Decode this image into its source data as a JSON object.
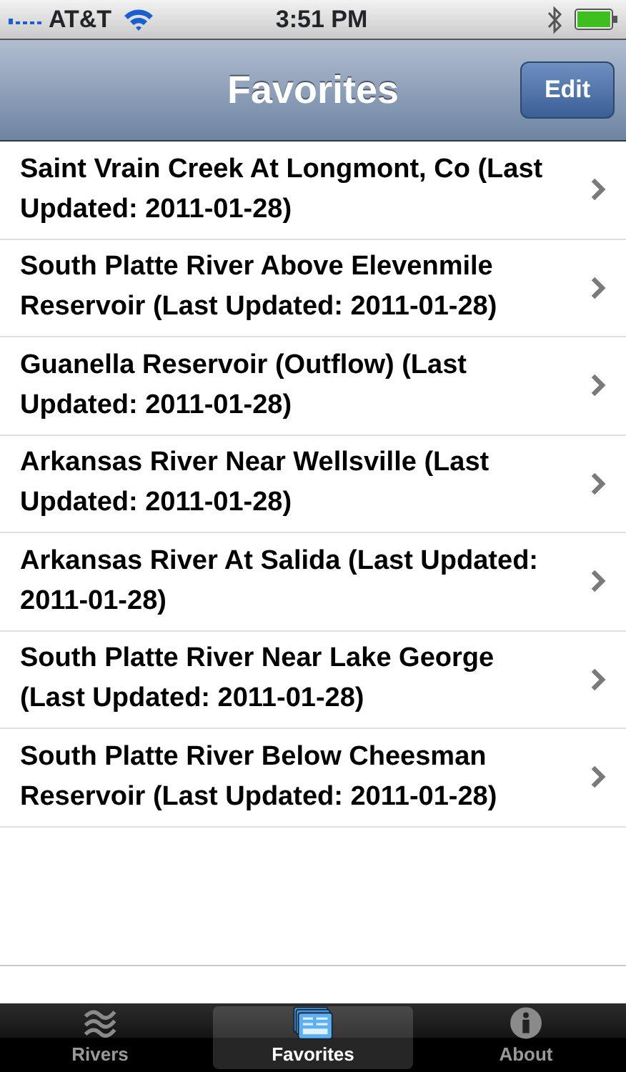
{
  "status_bar": {
    "carrier": "AT&T",
    "time": "3:51 PM"
  },
  "nav_bar": {
    "title": "Favorites",
    "edit_button": "Edit"
  },
  "favorites": [
    {
      "label": "Saint Vrain Creek At Longmont, Co (Last Updated: 2011-01-28)"
    },
    {
      "label": "South Platte River Above Elevenmile Reservoir (Last Updated: 2011-01-28)"
    },
    {
      "label": "Guanella Reservoir (Outflow) (Last Updated: 2011-01-28)"
    },
    {
      "label": "Arkansas River Near Wellsville (Last Updated: 2011-01-28)"
    },
    {
      "label": "Arkansas River At Salida (Last Updated: 2011-01-28)"
    },
    {
      "label": "South Platte River Near Lake George (Last Updated: 2011-01-28)"
    },
    {
      "label": "South Platte River Below Cheesman Reservoir (Last Updated: 2011-01-28)"
    }
  ],
  "tab_bar": [
    {
      "label": "Rivers",
      "selected": false
    },
    {
      "label": "Favorites",
      "selected": true
    },
    {
      "label": "About",
      "selected": false
    }
  ]
}
